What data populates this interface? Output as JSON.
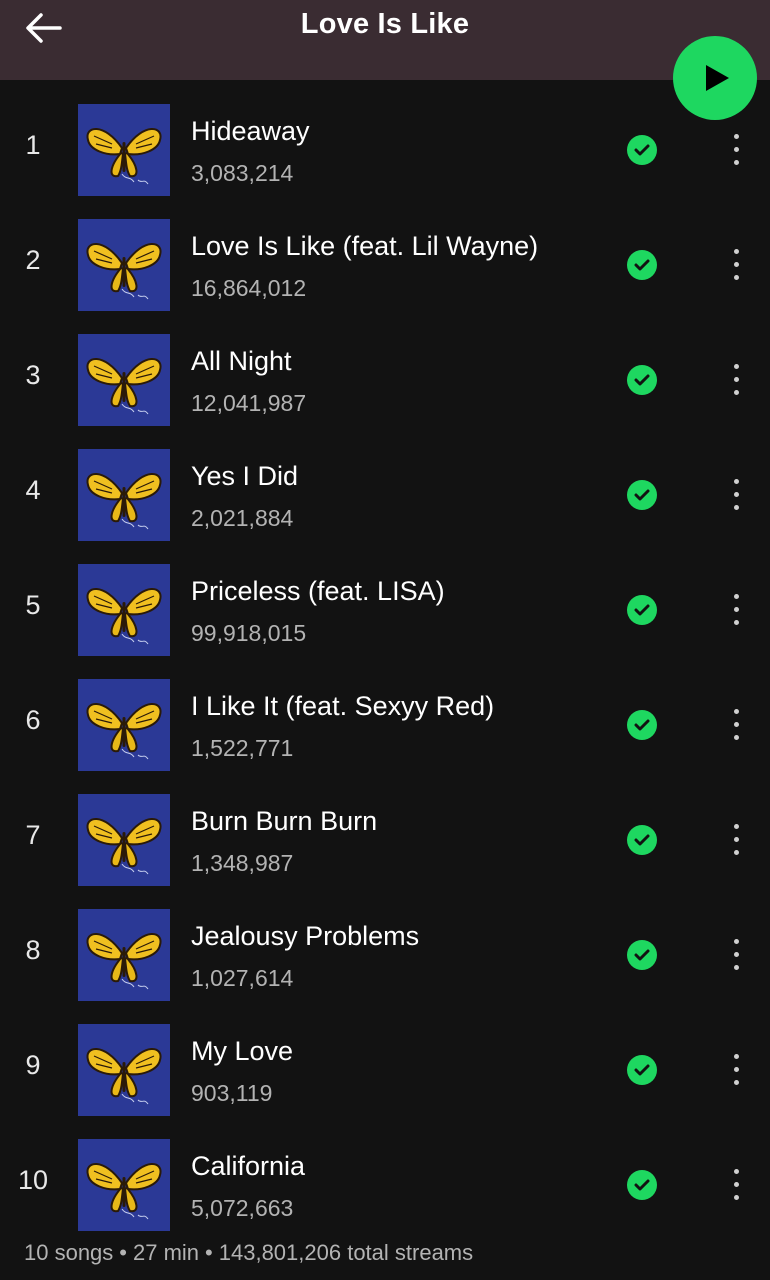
{
  "header": {
    "title": "Love Is Like",
    "back_icon": "arrow-left-icon",
    "play_icon": "play-icon"
  },
  "colors": {
    "accent": "#1ed760",
    "header_bg": "#3a2c32",
    "background": "#121212",
    "cover_bg": "#2b3996",
    "butterfly": "#f0c020"
  },
  "tracks": [
    {
      "number": "1",
      "title": "Hideaway",
      "streams": "3,083,214"
    },
    {
      "number": "2",
      "title": "Love Is Like (feat. Lil Wayne)",
      "streams": "16,864,012"
    },
    {
      "number": "3",
      "title": "All Night",
      "streams": "12,041,987"
    },
    {
      "number": "4",
      "title": "Yes I Did",
      "streams": "2,021,884"
    },
    {
      "number": "5",
      "title": "Priceless (feat. LISA)",
      "streams": "99,918,015"
    },
    {
      "number": "6",
      "title": "I Like It (feat. Sexyy Red)",
      "streams": "1,522,771"
    },
    {
      "number": "7",
      "title": "Burn Burn Burn",
      "streams": "1,348,987"
    },
    {
      "number": "8",
      "title": "Jealousy Problems",
      "streams": "1,027,614"
    },
    {
      "number": "9",
      "title": "My Love",
      "streams": "903,119"
    },
    {
      "number": "10",
      "title": "California",
      "streams": "5,072,663"
    }
  ],
  "footer": {
    "songs": "10 songs",
    "duration": "27 min",
    "streams": "143,801,206 total streams"
  }
}
